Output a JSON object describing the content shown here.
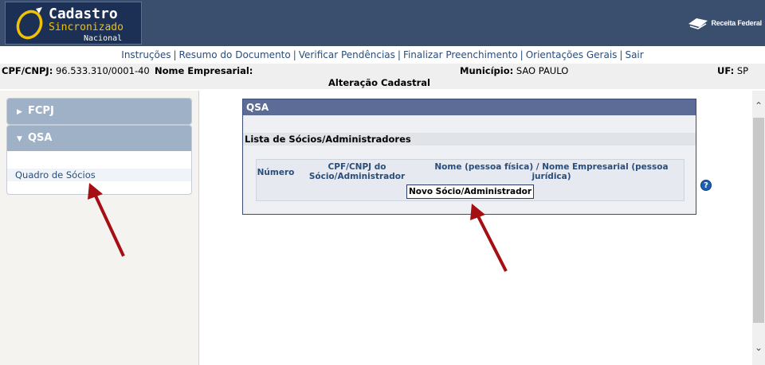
{
  "header": {
    "logo": {
      "line1": "Cadastro",
      "line2": "Sincronizado",
      "line3": "Nacional"
    },
    "brand": "Receita Federal"
  },
  "nav": {
    "items": [
      "Instruções",
      "Resumo do Documento",
      "Verificar Pendências",
      "Finalizar Preenchimento",
      "Orientações Gerais",
      "Sair"
    ]
  },
  "info": {
    "cpf_label": "CPF/CNPJ:",
    "cpf_value": "96.533.310/0001-40",
    "nome_label": "Nome Empresarial:",
    "municipio_label": "Município:",
    "municipio_value": "SAO PAULO",
    "uf_label": "UF:",
    "uf_value": "SP",
    "title": "Alteração Cadastral"
  },
  "sidebar": {
    "panels": [
      {
        "label": "FCPJ",
        "expanded": false
      },
      {
        "label": "QSA",
        "expanded": true,
        "links": [
          "Quadro de Sócios"
        ]
      }
    ]
  },
  "main": {
    "box_title": "QSA",
    "subtitle": "Lista de Sócios/Administradores",
    "columns": [
      "Número",
      "CPF/CNPJ do Sócio/Administrador",
      "Nome (pessoa física) / Nome Empresarial (pessoa jurídica)"
    ],
    "button": "Novo Sócio/Administrador",
    "help": "?"
  },
  "colors": {
    "header_bg": "#3a4e6d",
    "panel_head": "#9fb1c7",
    "box_title_bg": "#5d6c96",
    "arrow": "#a50f14"
  }
}
